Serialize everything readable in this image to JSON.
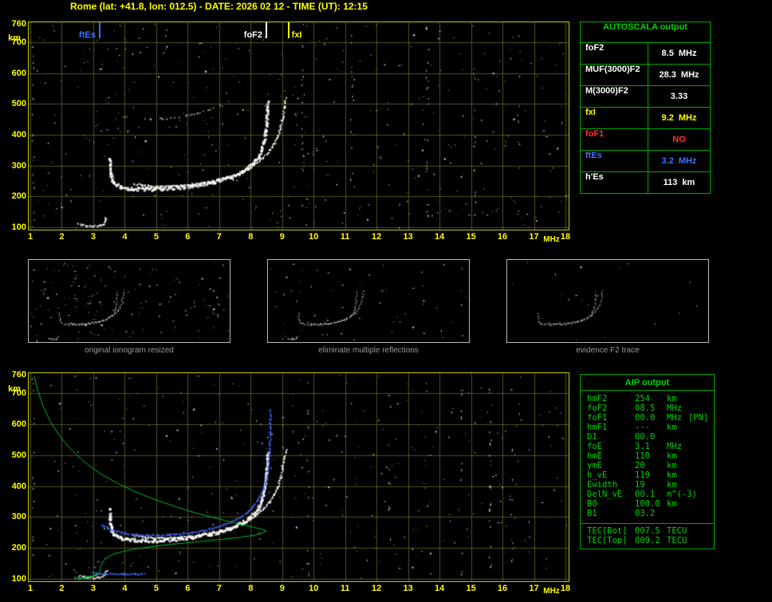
{
  "title": "Rome (lat: +41.8, lon: 012.5) - DATE: 2026 02 12 - TIME (UT): 12:15",
  "colors": {
    "axis_yellow": "#ffff00",
    "plot_border": "#c8c800",
    "grid": "#8a8a3c",
    "table_green_text": "#00d400",
    "table_green_border": "#00a800",
    "marker_blue": "#4070ff",
    "marker_white": "#ffffff",
    "marker_yellow": "#ffff00",
    "value_red": "#ff3030",
    "caption_gray": "#9a9a9a"
  },
  "autoscala_table": {
    "title": "AUTOSCALA output",
    "rows": [
      {
        "label": "foF2",
        "value": "8.5",
        "unit": "MHz",
        "color": "#ffffff"
      },
      {
        "label": "MUF(3000)F2",
        "value": "28.3",
        "unit": "MHz",
        "color": "#ffffff"
      },
      {
        "label": "M(3000)F2",
        "value": "3.33",
        "unit": "",
        "color": "#ffffff"
      },
      {
        "label": "fxI",
        "value": "9.2",
        "unit": "MHz",
        "color": "#ffff00"
      },
      {
        "label": "foF1",
        "value": "NO",
        "unit": "",
        "color": "#ff3030"
      },
      {
        "label": "ftEs",
        "value": "3.2",
        "unit": "MHz",
        "color": "#4070ff"
      },
      {
        "label": "h'Es",
        "value": "113",
        "unit": "km",
        "color": "#ffffff"
      }
    ]
  },
  "aip_table": {
    "title": "AIP output",
    "rows": [
      {
        "label": "hmF2",
        "value": "254",
        "unit": "km",
        "extra": ""
      },
      {
        "label": "foF2",
        "value": "08.5",
        "unit": "MHz",
        "extra": ""
      },
      {
        "label": "foF1",
        "value": "00.0",
        "unit": "MHz",
        "extra": "[PN]"
      },
      {
        "label": "hmF1",
        "value": "---",
        "unit": "km",
        "extra": ""
      },
      {
        "label": "D1",
        "value": "00.0",
        "unit": "",
        "extra": ""
      },
      {
        "label": "foE",
        "value": "3.1",
        "unit": "MHz",
        "extra": ""
      },
      {
        "label": "hmE",
        "value": "110",
        "unit": "km",
        "extra": ""
      },
      {
        "label": "ymE",
        "value": "20",
        "unit": "km",
        "extra": ""
      },
      {
        "label": "h_vE",
        "value": "119",
        "unit": "km",
        "extra": ""
      },
      {
        "label": "Ewidth",
        "value": "19",
        "unit": "km",
        "extra": ""
      },
      {
        "label": "DelN_vE",
        "value": "00.1",
        "unit": "m^(-3)",
        "extra": ""
      },
      {
        "label": "B0",
        "value": "100.0",
        "unit": "km",
        "extra": ""
      },
      {
        "label": "B1",
        "value": "03.2",
        "unit": "",
        "extra": ""
      }
    ],
    "tec_rows": [
      {
        "label": "TEC[Bot]",
        "value": "007.5",
        "unit": "TECU"
      },
      {
        "label": "TEC[Top]",
        "value": "009.2",
        "unit": "TECU"
      }
    ]
  },
  "thumbnails": [
    {
      "caption": "original ionogram resized",
      "include": [
        "es",
        "f2-ordinary",
        "f2-extra",
        "f2-multiple"
      ],
      "noise": 150,
      "alpha": 1
    },
    {
      "caption": "eliminate multiple reflections",
      "include": [
        "es",
        "f2-ordinary",
        "f2-extra"
      ],
      "noise": 60,
      "alpha": 1
    },
    {
      "caption": "evidence F2 trace",
      "include": [
        "f2-ordinary",
        "f2-extra"
      ],
      "noise": 22,
      "alpha": 0.9
    }
  ],
  "chart_data": [
    {
      "id": "top-ionogram",
      "type": "scatter",
      "title": "scaled ionogram with Autoscala characteristics",
      "xlabel": "MHz",
      "ylabel": "km",
      "xlim": [
        1,
        18
      ],
      "ylim": [
        100,
        760
      ],
      "x_ticks": [
        1,
        2,
        3,
        4,
        5,
        6,
        7,
        8,
        9,
        10,
        11,
        12,
        13,
        14,
        15,
        16,
        17,
        18
      ],
      "y_ticks": [
        760,
        700,
        600,
        500,
        400,
        300,
        200,
        100
      ],
      "grid": true,
      "seed": 11,
      "noise_dots": 430,
      "noise_streaks": [
        {
          "f": 1.08,
          "n": 16
        },
        {
          "f": 9.65,
          "n": 20
        },
        {
          "f": 11.2,
          "n": 12
        },
        {
          "f": 13.6,
          "n": 18
        },
        {
          "f": 15.1,
          "n": 14
        },
        {
          "f": 16.5,
          "n": 10
        }
      ],
      "markers": [
        {
          "label": "ftEs",
          "f": 3.2,
          "color": "#4070ff",
          "side": "left"
        },
        {
          "label": "foF2",
          "f": 8.5,
          "color": "#ffffff",
          "side": "left"
        },
        {
          "label": "fxI",
          "f": 9.2,
          "color": "#ffff00",
          "side": "right"
        }
      ],
      "traces": [
        {
          "name": "es",
          "color": "#f0f0f0",
          "size": 2,
          "mode": "dots",
          "points": [
            [
              2.5,
              113
            ],
            [
              2.62,
              110
            ],
            [
              2.74,
              107
            ],
            [
              2.86,
              106
            ],
            [
              2.98,
              105
            ],
            [
              3.1,
              106
            ],
            [
              3.2,
              108
            ],
            [
              3.3,
              112
            ],
            [
              3.36,
              120
            ],
            [
              3.4,
              131
            ]
          ]
        },
        {
          "name": "f2-ordinary",
          "color": "#ffffff",
          "size": 3,
          "mode": "dots",
          "points": [
            [
              3.5,
              330
            ],
            [
              3.5,
              302
            ],
            [
              3.52,
              280
            ],
            [
              3.56,
              261
            ],
            [
              3.62,
              248
            ],
            [
              3.72,
              240
            ],
            [
              3.86,
              234
            ],
            [
              4.05,
              230
            ],
            [
              4.3,
              228
            ],
            [
              4.6,
              227
            ],
            [
              4.9,
              227
            ],
            [
              5.2,
              228
            ],
            [
              5.5,
              230
            ],
            [
              5.8,
              233
            ],
            [
              6.1,
              237
            ],
            [
              6.4,
              242
            ],
            [
              6.7,
              248
            ],
            [
              7.0,
              255
            ],
            [
              7.25,
              263
            ],
            [
              7.5,
              273
            ],
            [
              7.7,
              284
            ],
            [
              7.9,
              297
            ],
            [
              8.08,
              313
            ],
            [
              8.22,
              332
            ],
            [
              8.32,
              355
            ],
            [
              8.4,
              382
            ],
            [
              8.45,
              412
            ],
            [
              8.48,
              445
            ],
            [
              8.5,
              478
            ],
            [
              8.52,
              510
            ]
          ]
        },
        {
          "name": "f2-extra",
          "color": "#ffffff",
          "size": 2,
          "mode": "dots",
          "points": [
            [
              4.25,
              243
            ],
            [
              4.55,
              238
            ],
            [
              4.85,
              235
            ],
            [
              5.15,
              234
            ],
            [
              5.45,
              235
            ],
            [
              5.75,
              237
            ],
            [
              6.05,
              240
            ],
            [
              6.35,
              244
            ],
            [
              6.65,
              249
            ],
            [
              6.95,
              256
            ],
            [
              7.25,
              264
            ],
            [
              7.5,
              273
            ],
            [
              7.75,
              284
            ],
            [
              8.0,
              297
            ],
            [
              8.2,
              312
            ],
            [
              8.4,
              330
            ],
            [
              8.58,
              350
            ],
            [
              8.72,
              372
            ],
            [
              8.84,
              398
            ],
            [
              8.93,
              428
            ],
            [
              9.0,
              460
            ],
            [
              9.06,
              492
            ],
            [
              9.1,
              520
            ]
          ]
        },
        {
          "name": "f2-multiple",
          "color": "#d8d8d8",
          "size": 2,
          "mode": "dots",
          "sparse": 0.4,
          "alpha": 0.7,
          "points": [
            [
              3.9,
              462
            ],
            [
              4.3,
              456
            ],
            [
              4.8,
              453
            ],
            [
              5.3,
              455
            ],
            [
              5.8,
              462
            ],
            [
              6.3,
              472
            ],
            [
              6.7,
              486
            ],
            [
              7.0,
              500
            ]
          ]
        }
      ]
    },
    {
      "id": "bottom-ionogram",
      "type": "scatter",
      "title": "ionogram with fitted trace and electron density profile",
      "xlabel": "MHz",
      "ylabel": "km",
      "xlim": [
        1,
        18
      ],
      "ylim": [
        100,
        760
      ],
      "x_ticks": [
        1,
        2,
        3,
        4,
        5,
        6,
        7,
        8,
        9,
        10,
        11,
        12,
        13,
        14,
        15,
        16,
        17,
        18
      ],
      "y_ticks": [
        760,
        700,
        600,
        500,
        400,
        300,
        200,
        100
      ],
      "grid": true,
      "seed": 29,
      "noise_dots": 360,
      "noise_streaks": [
        {
          "f": 1.08,
          "n": 14
        },
        {
          "f": 9.8,
          "n": 14
        },
        {
          "f": 12.4,
          "n": 10
        },
        {
          "f": 14.7,
          "n": 12
        },
        {
          "f": 15.6,
          "n": 26
        },
        {
          "f": 16.3,
          "n": 10
        }
      ],
      "markers": [],
      "include_top_traces": [
        "es",
        "f2-ordinary",
        "f2-extra"
      ],
      "traces": [
        {
          "name": "fit-f2",
          "color": "#4466ff",
          "size": 2,
          "mode": "dots",
          "points": [
            [
              3.25,
              278
            ],
            [
              3.45,
              266
            ],
            [
              3.7,
              256
            ],
            [
              4.0,
              249
            ],
            [
              4.35,
              245
            ],
            [
              4.7,
              243
            ],
            [
              5.05,
              243
            ],
            [
              5.4,
              245
            ],
            [
              5.75,
              248
            ],
            [
              6.1,
              252
            ],
            [
              6.45,
              258
            ],
            [
              6.8,
              266
            ],
            [
              7.1,
              276
            ],
            [
              7.4,
              288
            ],
            [
              7.65,
              302
            ],
            [
              7.88,
              318
            ],
            [
              8.08,
              338
            ],
            [
              8.25,
              362
            ],
            [
              8.38,
              390
            ],
            [
              8.47,
              422
            ],
            [
              8.53,
              458
            ],
            [
              8.57,
              496
            ],
            [
              8.59,
              535
            ],
            [
              8.6,
              575
            ],
            [
              8.6,
              615
            ],
            [
              8.6,
              648
            ]
          ]
        },
        {
          "name": "fit-es",
          "color": "#4466ff",
          "size": 2,
          "mode": "dots",
          "points": [
            [
              2.95,
              123
            ],
            [
              3.25,
              120
            ],
            [
              3.6,
              118
            ],
            [
              3.95,
              117
            ],
            [
              4.3,
              117
            ],
            [
              4.6,
              118
            ]
          ]
        },
        {
          "name": "profile-topside",
          "color": "#00bb33",
          "size": 1,
          "mode": "line",
          "points": [
            [
              1.12,
              758
            ],
            [
              1.25,
              706
            ],
            [
              1.42,
              655
            ],
            [
              1.65,
              606
            ],
            [
              1.95,
              560
            ],
            [
              2.3,
              517
            ],
            [
              2.72,
              478
            ],
            [
              3.2,
              442
            ],
            [
              3.75,
              410
            ],
            [
              4.35,
              381
            ],
            [
              5.0,
              355
            ],
            [
              5.65,
              332
            ],
            [
              6.3,
              312
            ],
            [
              6.95,
              295
            ],
            [
              7.55,
              280
            ],
            [
              8.05,
              268
            ],
            [
              8.4,
              259
            ],
            [
              8.5,
              255
            ]
          ]
        },
        {
          "name": "profile-bottomside",
          "color": "#00bb33",
          "size": 1,
          "mode": "line",
          "points": [
            [
              8.5,
              255
            ],
            [
              8.35,
              247
            ],
            [
              8.1,
              241
            ],
            [
              7.7,
              235
            ],
            [
              7.2,
              229
            ],
            [
              6.6,
              223
            ],
            [
              6.0,
              217
            ],
            [
              5.4,
              211
            ],
            [
              4.85,
              204
            ],
            [
              4.35,
              197
            ],
            [
              3.95,
              189
            ],
            [
              3.65,
              180
            ],
            [
              3.45,
              170
            ],
            [
              3.32,
              158
            ],
            [
              3.25,
              145
            ],
            [
              3.22,
              132
            ],
            [
              3.2,
              120
            ],
            [
              3.18,
              112
            ]
          ]
        },
        {
          "name": "profile-e",
          "color": "#00cc44",
          "size": 2,
          "mode": "dots",
          "points": [
            [
              2.45,
              103
            ],
            [
              2.6,
              105
            ],
            [
              2.75,
              108
            ],
            [
              2.9,
              111
            ],
            [
              3.02,
              114
            ],
            [
              3.1,
              117
            ]
          ]
        }
      ]
    }
  ]
}
